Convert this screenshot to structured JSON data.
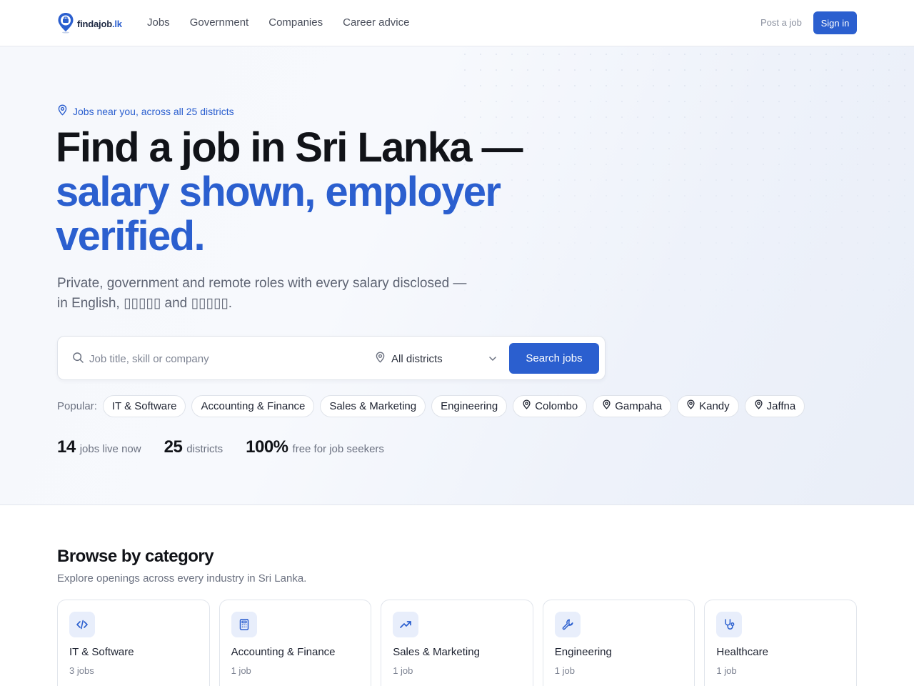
{
  "brand": {
    "name": "findajob",
    "tld": ".lk",
    "accent": "#2b5fcf"
  },
  "nav": {
    "links": [
      "Jobs",
      "Government",
      "Companies",
      "Career advice"
    ],
    "post_job": "Post a job",
    "sign_in": "Sign in"
  },
  "hero": {
    "eyebrow": "Jobs near you, across all 25 districts",
    "headline_line1": "Find a job in Sri Lanka —",
    "headline_line2": "salary shown, employer verified.",
    "subtitle_line1": "Private, government and remote roles with every salary disclosed —",
    "subtitle_line2": "in English, ▯▯▯▯▯ and ▯▯▯▯▯."
  },
  "search": {
    "placeholder": "Job title, skill or company",
    "value": "",
    "district_selected": "All districts",
    "button": "Search jobs"
  },
  "popular": {
    "label": "Popular:",
    "chips": [
      {
        "label": "IT & Software",
        "location": false
      },
      {
        "label": "Accounting & Finance",
        "location": false
      },
      {
        "label": "Sales & Marketing",
        "location": false
      },
      {
        "label": "Engineering",
        "location": false
      },
      {
        "label": "Colombo",
        "location": true
      },
      {
        "label": "Gampaha",
        "location": true
      },
      {
        "label": "Kandy",
        "location": true
      },
      {
        "label": "Jaffna",
        "location": true
      }
    ]
  },
  "stats": [
    {
      "number": "14",
      "label": "jobs live now"
    },
    {
      "number": "25",
      "label": "districts"
    },
    {
      "number": "100%",
      "label": "free for job seekers"
    }
  ],
  "categories": {
    "title": "Browse by category",
    "subtitle": "Explore openings across every industry in Sri Lanka.",
    "items": [
      {
        "name": "IT & Software",
        "count": "3 jobs",
        "icon": "code-icon"
      },
      {
        "name": "Accounting & Finance",
        "count": "1 job",
        "icon": "calculator-icon"
      },
      {
        "name": "Sales & Marketing",
        "count": "1 job",
        "icon": "trending-up-icon"
      },
      {
        "name": "Engineering",
        "count": "1 job",
        "icon": "wrench-icon"
      },
      {
        "name": "Healthcare",
        "count": "1 job",
        "icon": "stethoscope-icon"
      }
    ]
  }
}
